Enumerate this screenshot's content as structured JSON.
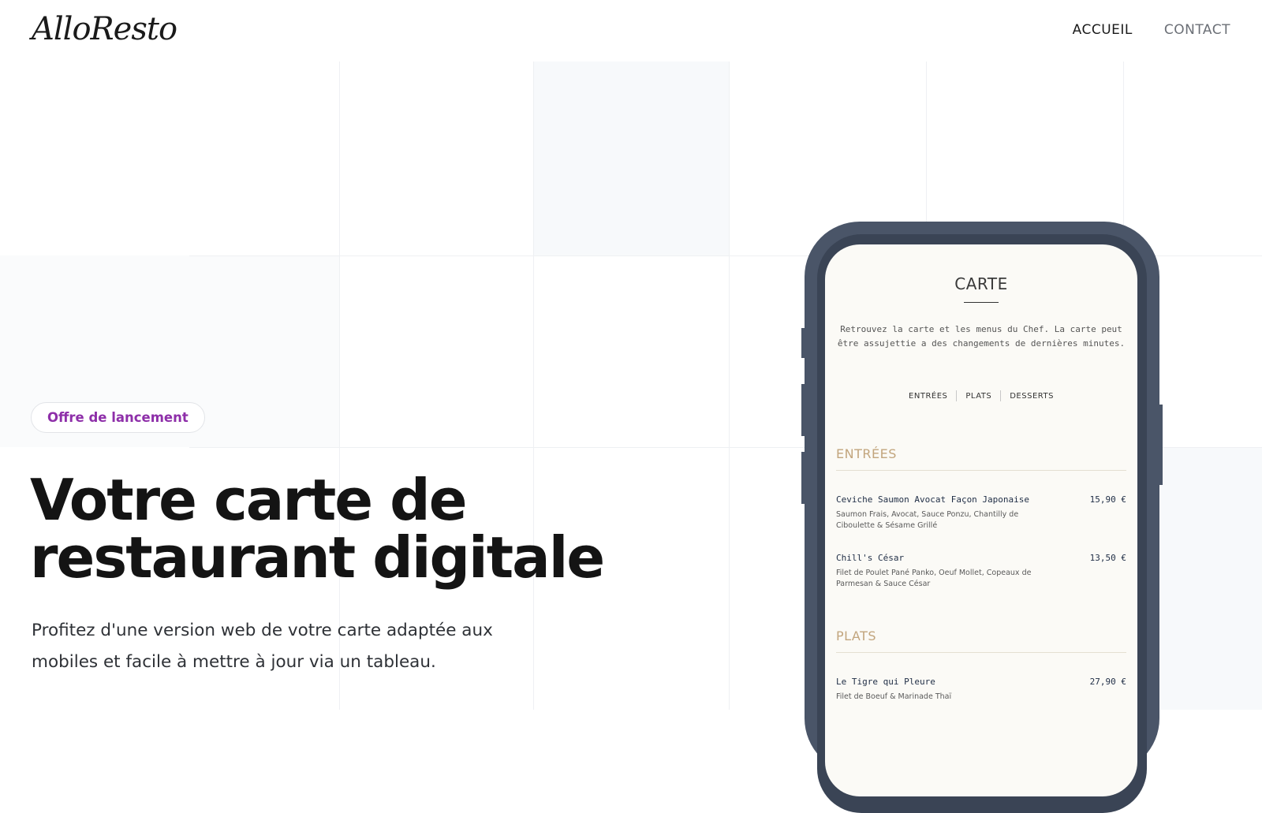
{
  "header": {
    "logo": "AlloResto",
    "nav": [
      {
        "label": "ACCUEIL"
      },
      {
        "label": "CONTACT"
      }
    ]
  },
  "hero": {
    "badge": "Offre de lancement",
    "title": "Votre carte de restaurant digitale",
    "subtitle": "Profitez d'une version web de votre carte adaptée aux mobiles et facile à mettre à jour via un tableau."
  },
  "menu": {
    "title": "CARTE",
    "intro": "Retrouvez la carte et les menus du Chef. La carte peut être assujettie a des changements de dernières minutes.",
    "tabs": [
      "ENTRÉES",
      "PLATS",
      "DESSERTS"
    ],
    "sections": [
      {
        "title": "ENTRÉES",
        "items": [
          {
            "name": "Ceviche Saumon Avocat Façon Japonaise",
            "price": "15,90 €",
            "description": "Saumon Frais, Avocat, Sauce Ponzu, Chantilly de Ciboulette & Sésame Grillé"
          },
          {
            "name": "Chill's César",
            "price": "13,50 €",
            "description": "Filet de Poulet Pané Panko, Oeuf Mollet, Copeaux de Parmesan & Sauce César"
          }
        ]
      },
      {
        "title": "PLATS",
        "items": [
          {
            "name": "Le Tigre qui Pleure",
            "price": "27,90 €",
            "description": "Filet de Boeuf & Marinade Thaï"
          }
        ]
      }
    ]
  },
  "colors": {
    "accent_purple": "#8e2fa9",
    "phone_frame": "#4a5568",
    "section_gold": "#c2a57d",
    "text_dark": "#141414"
  }
}
